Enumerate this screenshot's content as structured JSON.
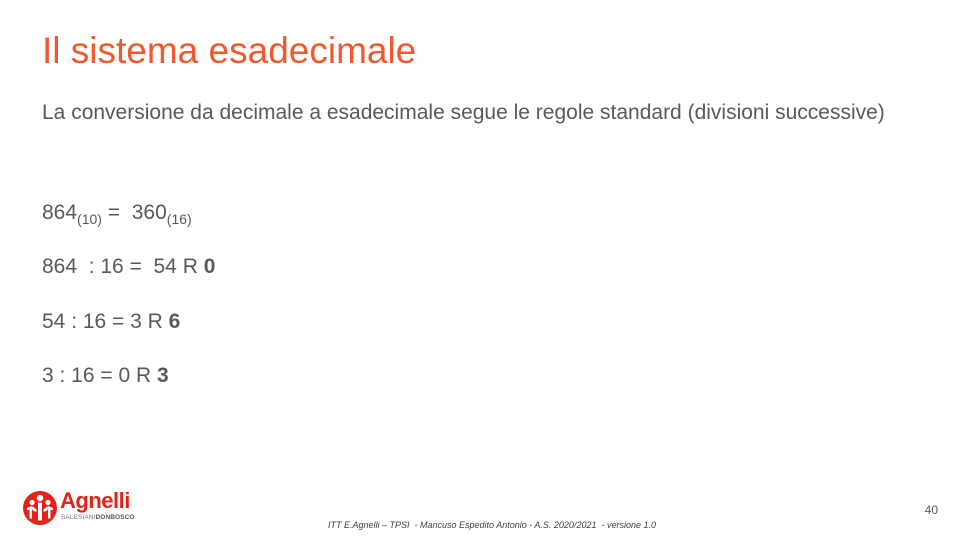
{
  "slide": {
    "title": "Il sistema esadecimale",
    "intro": "La conversione da decimale a esadecimale segue le regole standard (divisioni successive)",
    "equation": {
      "left_value": "864",
      "left_base": "(10)",
      "operator": " =  ",
      "right_value": "360",
      "right_base": "(16)"
    },
    "steps": [
      {
        "expression": "864  : 16 =  54 R ",
        "remainder": "0"
      },
      {
        "expression": "54 : 16 = 3 R ",
        "remainder": "6"
      },
      {
        "expression": "3 : 16 = 0 R ",
        "remainder": "3"
      }
    ]
  },
  "logo": {
    "name": "Agnelli",
    "sub_light": "SALESIANI",
    "sub_bold": "DONBOSCO",
    "color": "#e2231a"
  },
  "footer": {
    "text": "ITT E.Agnelli – TPSI  - Mancuso Espedito Antonio - A.S. 2020/2021  - versione 1.0",
    "page_number": "40"
  },
  "colors": {
    "title": "#f0582e",
    "body_text": "#595959"
  }
}
